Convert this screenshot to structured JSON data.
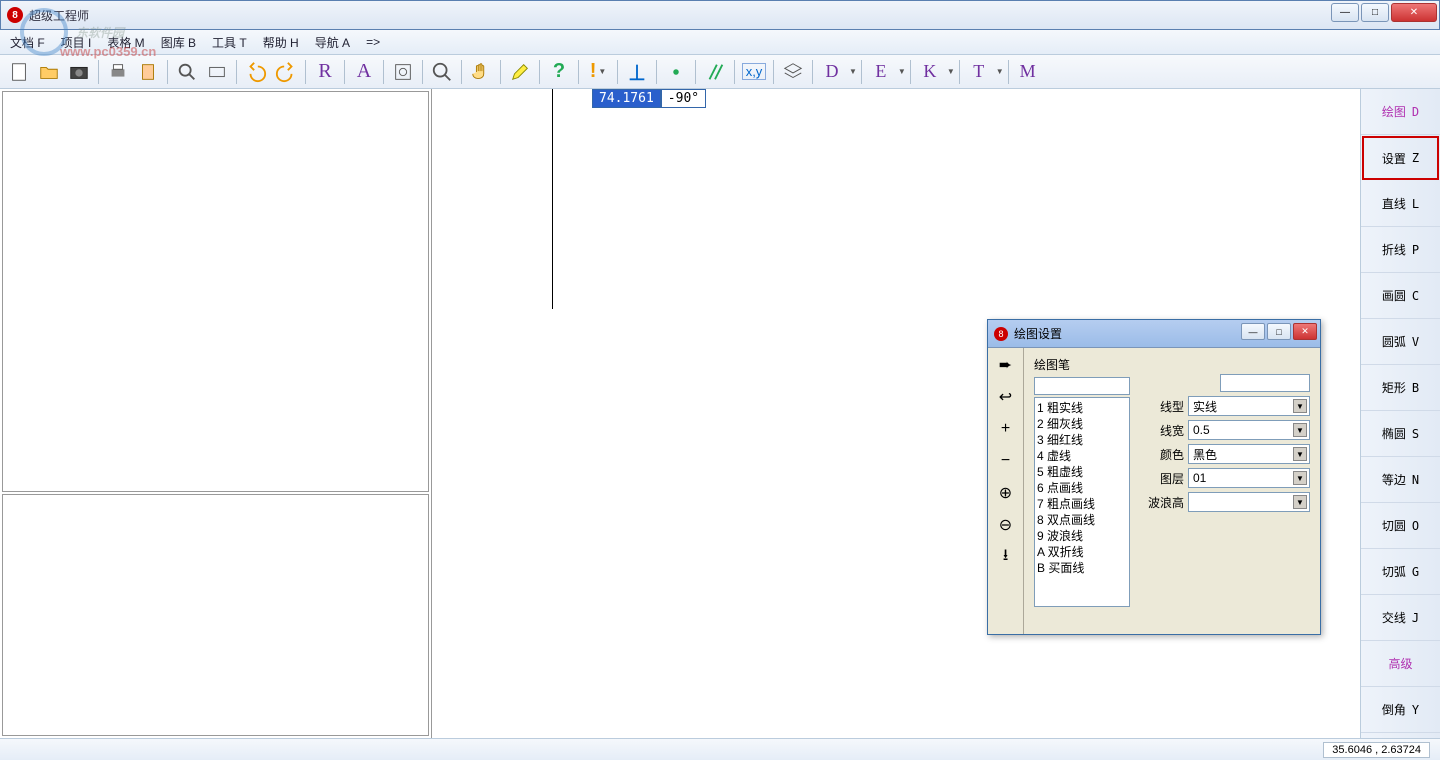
{
  "window": {
    "title": "超级工程师",
    "controls": {
      "min": "—",
      "max": "□",
      "close": "✕"
    }
  },
  "watermark": {
    "text": "东软件园",
    "url": "www.pc0359.cn"
  },
  "menubar": [
    "文档 F",
    "项目 I",
    "表格 M",
    "图库 B",
    "工具 T",
    "帮助 H",
    "导航 A",
    "=>"
  ],
  "toolbar_letters": [
    "R",
    "A"
  ],
  "toolbar_right_letters": [
    "D",
    "E",
    "K",
    "T",
    "M"
  ],
  "canvas": {
    "coord1": "74.1761",
    "coord2": "-90°"
  },
  "right_sidebar": [
    {
      "label": "绘图",
      "key": "D",
      "highlight": true
    },
    {
      "label": "设置",
      "key": "Z",
      "boxed": true
    },
    {
      "label": "直线",
      "key": "L"
    },
    {
      "label": "折线",
      "key": "P"
    },
    {
      "label": "画圆",
      "key": "C"
    },
    {
      "label": "圆弧",
      "key": "V"
    },
    {
      "label": "矩形",
      "key": "B"
    },
    {
      "label": "椭圆",
      "key": "S"
    },
    {
      "label": "等边",
      "key": "N"
    },
    {
      "label": "切圆",
      "key": "O"
    },
    {
      "label": "切弧",
      "key": "G"
    },
    {
      "label": "交线",
      "key": "J"
    },
    {
      "label": "高级",
      "key": "",
      "highlight": true
    },
    {
      "label": "倒角",
      "key": "Y"
    }
  ],
  "dialog": {
    "title": "绘图设置",
    "group_label": "绘图笔",
    "list": [
      "1 粗实线",
      "2 细灰线",
      "3 细红线",
      "4 虚线",
      "5 粗虚线",
      "6 点画线",
      "7 粗点画线",
      "8 双点画线",
      "9 波浪线",
      "A 双折线",
      "B 买面线"
    ],
    "fields": {
      "linetype": {
        "label": "线型",
        "value": "实线"
      },
      "linewidth": {
        "label": "线宽",
        "value": "0.5"
      },
      "color": {
        "label": "颜色",
        "value": "黑色"
      },
      "layer": {
        "label": "图层",
        "value": "01"
      },
      "waveheight": {
        "label": "波浪高",
        "value": ""
      }
    }
  },
  "status": {
    "coords": "35.6046    , 2.63724"
  }
}
